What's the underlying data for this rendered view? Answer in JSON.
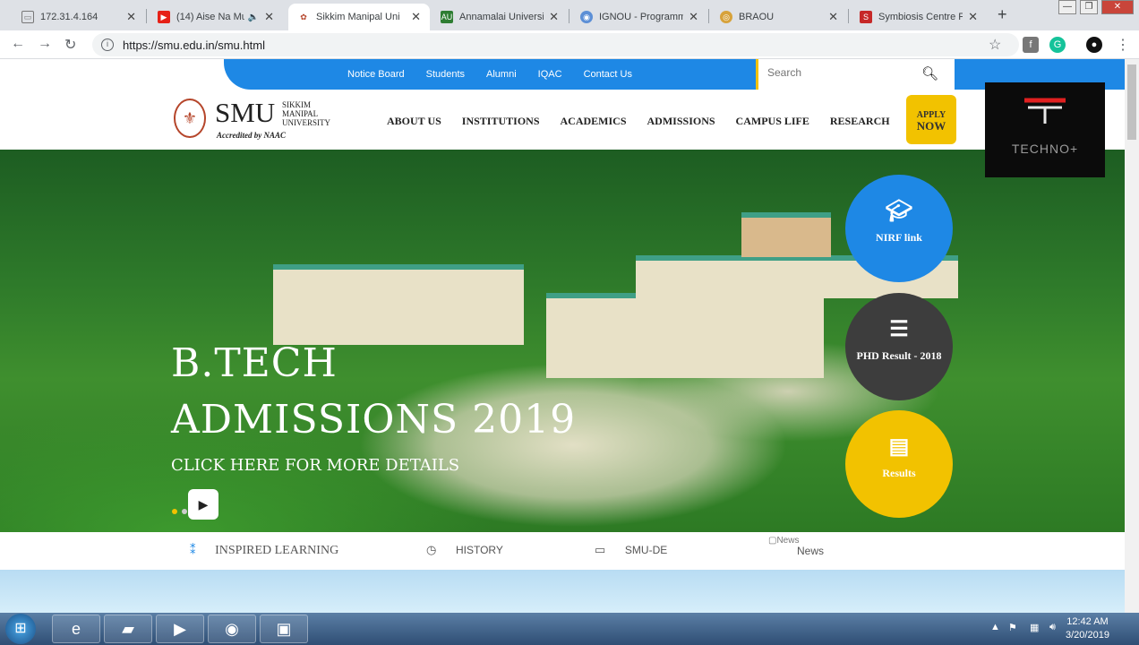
{
  "browser": {
    "tabs": [
      {
        "title": "172.31.4.164",
        "icon": "page-icon"
      },
      {
        "title": "(14) Aise Na Mu",
        "icon": "youtube-icon"
      },
      {
        "title": "Sikkim Manipal Uni",
        "icon": "smu-icon",
        "active": true
      },
      {
        "title": "Annamalai Universi",
        "icon": "annamalai-icon"
      },
      {
        "title": "IGNOU - Programm",
        "icon": "ignou-icon"
      },
      {
        "title": "BRAOU",
        "icon": "braou-icon"
      },
      {
        "title": "Symbiosis Centre F",
        "icon": "symbiosis-icon"
      }
    ],
    "url": "https://smu.edu.in/smu.html"
  },
  "site": {
    "top_links": [
      "Notice Board",
      "Students",
      "Alumni",
      "IQAC",
      "Contact Us"
    ],
    "search_placeholder": "Search",
    "logo": {
      "short": "SMU",
      "full": "SIKKIM MANIPAL UNIVERSITY",
      "accreditation": "Accredited by NAAC"
    },
    "main_nav": [
      "ABOUT US",
      "INSTITUTIONS",
      "ACADEMICS",
      "ADMISSIONS",
      "CAMPUS LIFE",
      "RESEARCH"
    ],
    "apply": {
      "line1": "APPLY",
      "line2": "NOW"
    },
    "hero": {
      "title_line1": "B.TECH",
      "title_line2": "ADMISSIONS 2019",
      "cta": "CLICK HERE FOR MORE DETAILS"
    },
    "quick_links": [
      {
        "label": "NIRF link",
        "color": "#1e88e5",
        "icon": "graduation-cap-icon"
      },
      {
        "label": "PHD Result - 2018",
        "color": "#3d3d3d",
        "icon": "search-document-icon"
      },
      {
        "label": "Results",
        "color": "#f2c200",
        "icon": "id-card-icon"
      }
    ],
    "sub_nav": [
      "INSPIRED LEARNING",
      "HISTORY",
      "SMU-DE",
      "News"
    ],
    "news_alt": "News"
  },
  "overlay": {
    "watermark": "TECHNO+"
  },
  "taskbar": {
    "time": "12:42 AM",
    "date": "3/20/2019"
  }
}
